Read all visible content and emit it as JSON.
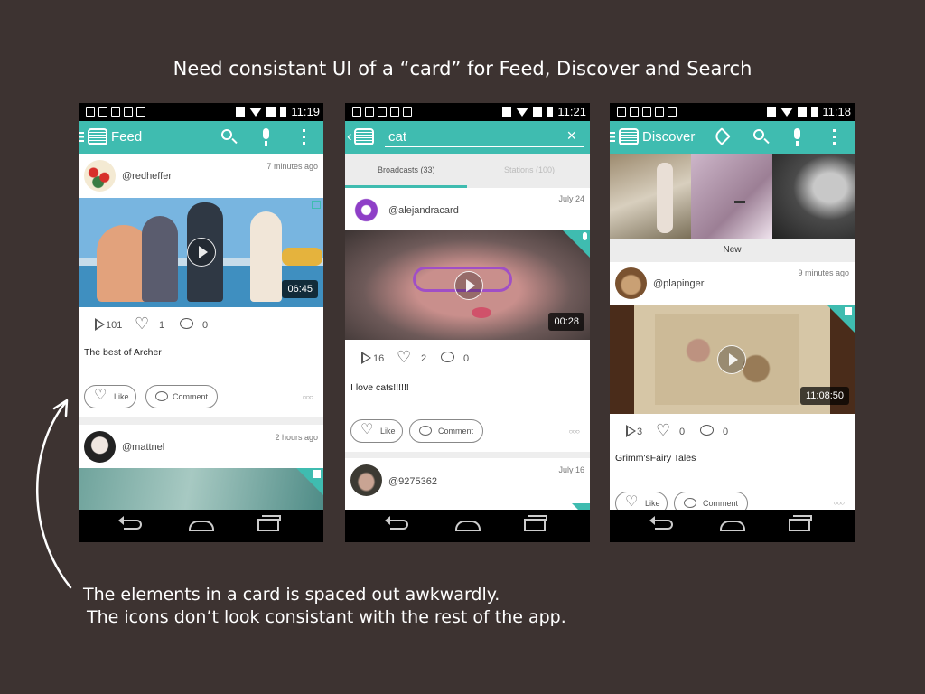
{
  "heading": "Need consistant UI of a “card” for Feed, Discover and Search",
  "annotation": {
    "line1": "The elements in a card is spaced out awkwardly.",
    "line2": "The icons don’t look consistant with the rest of the app."
  },
  "colors": {
    "accent": "#3fbcb0",
    "background": "#3d3331"
  },
  "phones": {
    "feed": {
      "status_time": "11:19",
      "title": "Feed",
      "card1": {
        "username": "@redheffer",
        "time": "7 minutes ago",
        "duration": "06:45",
        "plays": "101",
        "likes": "1",
        "comments": "0",
        "caption": "The best of Archer",
        "like_label": "Like",
        "comment_label": "Comment"
      },
      "card2": {
        "username": "@mattnel",
        "time": "2 hours ago"
      }
    },
    "search": {
      "status_time": "11:21",
      "query": "cat",
      "tab_broadcasts": "Broadcasts (33)",
      "tab_stations": "Stations (100)",
      "card1": {
        "username": "@alejandracard",
        "time": "July 24",
        "duration": "00:28",
        "plays": "16",
        "likes": "2",
        "comments": "0",
        "caption": "I love cats!!!!!!",
        "like_label": "Like",
        "comment_label": "Comment"
      },
      "card2": {
        "username": "@9275362",
        "time": "July 16"
      }
    },
    "discover": {
      "status_time": "11:18",
      "title": "Discover",
      "new_label": "New",
      "card1": {
        "username": "@plapinger",
        "time": "9 minutes ago",
        "duration": "11:08:50",
        "plays": "3",
        "likes": "0",
        "comments": "0",
        "caption": "Grimm'sFairy Tales",
        "like_label": "Like",
        "comment_label": "Comment"
      }
    }
  }
}
